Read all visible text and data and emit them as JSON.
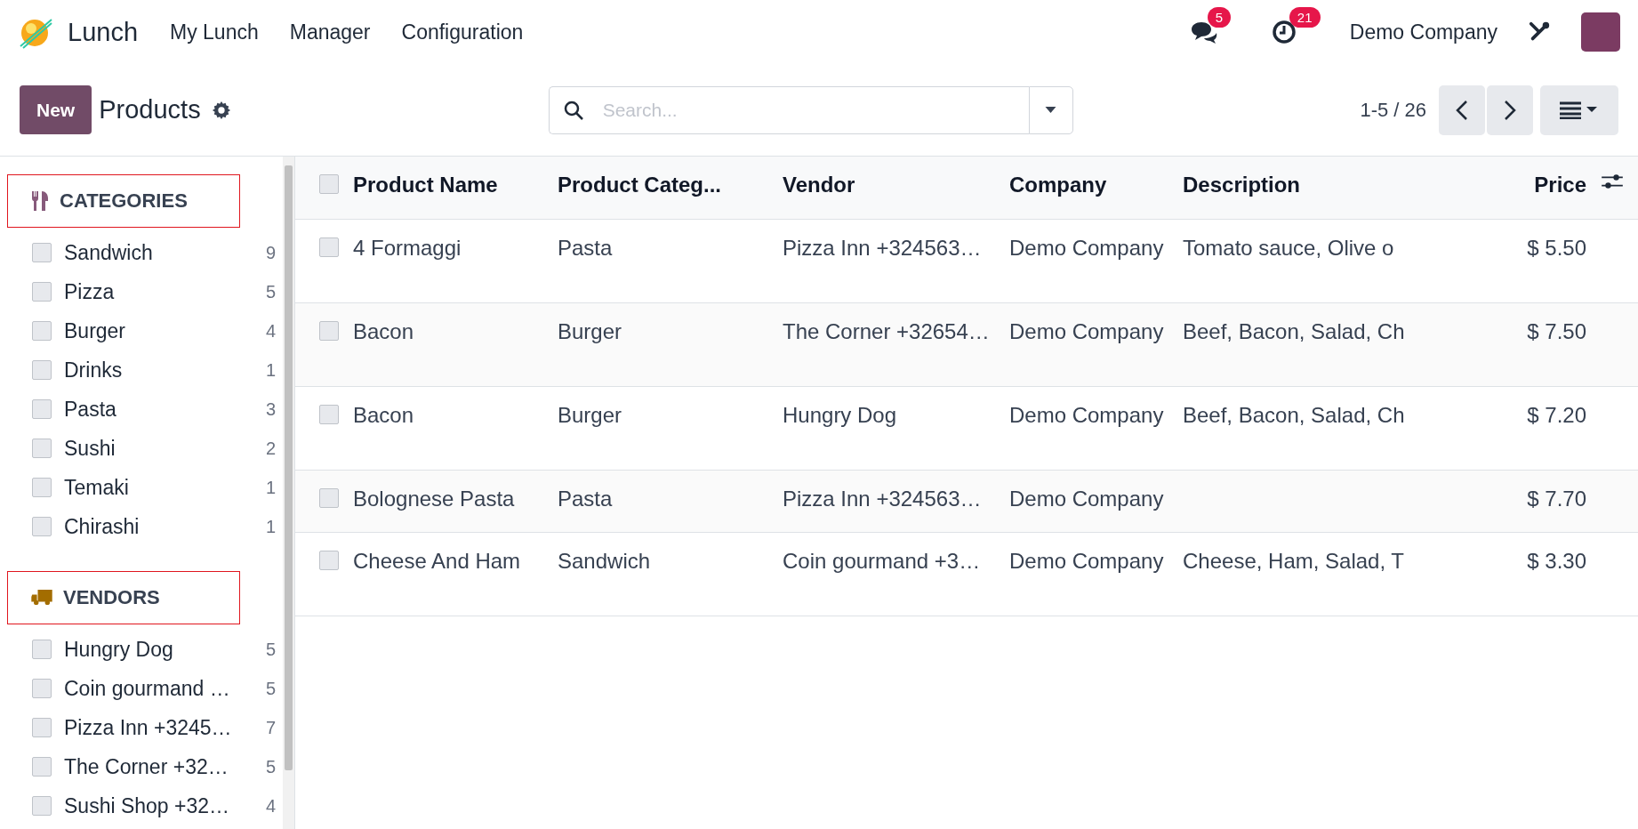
{
  "navbar": {
    "app_name": "Lunch",
    "menu": [
      "My Lunch",
      "Manager",
      "Configuration"
    ],
    "messages_badge": "5",
    "activities_badge": "21",
    "company": "Demo Company"
  },
  "control_panel": {
    "new_button": "New",
    "title": "Products",
    "search": {
      "placeholder": "Search..."
    },
    "pager": "1-5 / 26"
  },
  "sidebar": {
    "sections": [
      {
        "kind": "categories",
        "title": "CATEGORIES",
        "items": [
          {
            "label": "Sandwich",
            "count": "9",
            "checked": false
          },
          {
            "label": "Pizza",
            "count": "5",
            "checked": false
          },
          {
            "label": "Burger",
            "count": "4",
            "checked": false
          },
          {
            "label": "Drinks",
            "count": "1",
            "checked": false
          },
          {
            "label": "Pasta",
            "count": "3",
            "checked": false
          },
          {
            "label": "Sushi",
            "count": "2",
            "checked": false
          },
          {
            "label": "Temaki",
            "count": "1",
            "checked": false
          },
          {
            "label": "Chirashi",
            "count": "1",
            "checked": false
          }
        ]
      },
      {
        "kind": "vendors",
        "title": "VENDORS",
        "items": [
          {
            "label": "Hungry Dog",
            "count": "5",
            "checked": false
          },
          {
            "label": "Coin gourmand …",
            "count": "5",
            "checked": false
          },
          {
            "label": "Pizza Inn +3245…",
            "count": "7",
            "checked": false
          },
          {
            "label": "The Corner +32…",
            "count": "5",
            "checked": false
          },
          {
            "label": "Sushi Shop +32…",
            "count": "4",
            "checked": false
          }
        ]
      }
    ]
  },
  "table": {
    "select_all": {
      "checked": false
    },
    "columns": [
      "Product Name",
      "Product Categ...",
      "Vendor",
      "Company",
      "Description",
      "Price"
    ],
    "rows": [
      {
        "checked": false,
        "cells": [
          "4 Formaggi",
          "Pasta",
          "Pizza Inn +324563…",
          "Demo Company",
          "Tomato sauce, Olive o",
          "$ 5.50"
        ]
      },
      {
        "checked": false,
        "cells": [
          "Bacon",
          "Burger",
          "The Corner +32654…",
          "Demo Company",
          "Beef, Bacon, Salad, Ch",
          "$ 7.50"
        ]
      },
      {
        "checked": false,
        "cells": [
          "Bacon",
          "Burger",
          "Hungry Dog",
          "Demo Company",
          "Beef, Bacon, Salad, Ch",
          "$ 7.20"
        ]
      },
      {
        "checked": false,
        "cells": [
          "Bolognese Pasta",
          "Pasta",
          "Pizza Inn +324563…",
          "Demo Company",
          "",
          "$ 7.70"
        ]
      },
      {
        "checked": false,
        "cells": [
          "Cheese And Ham",
          "Sandwich",
          "Coin gourmand +3…",
          "Demo Company",
          "Cheese, Ham, Salad, T",
          "$ 3.30"
        ]
      }
    ]
  }
}
